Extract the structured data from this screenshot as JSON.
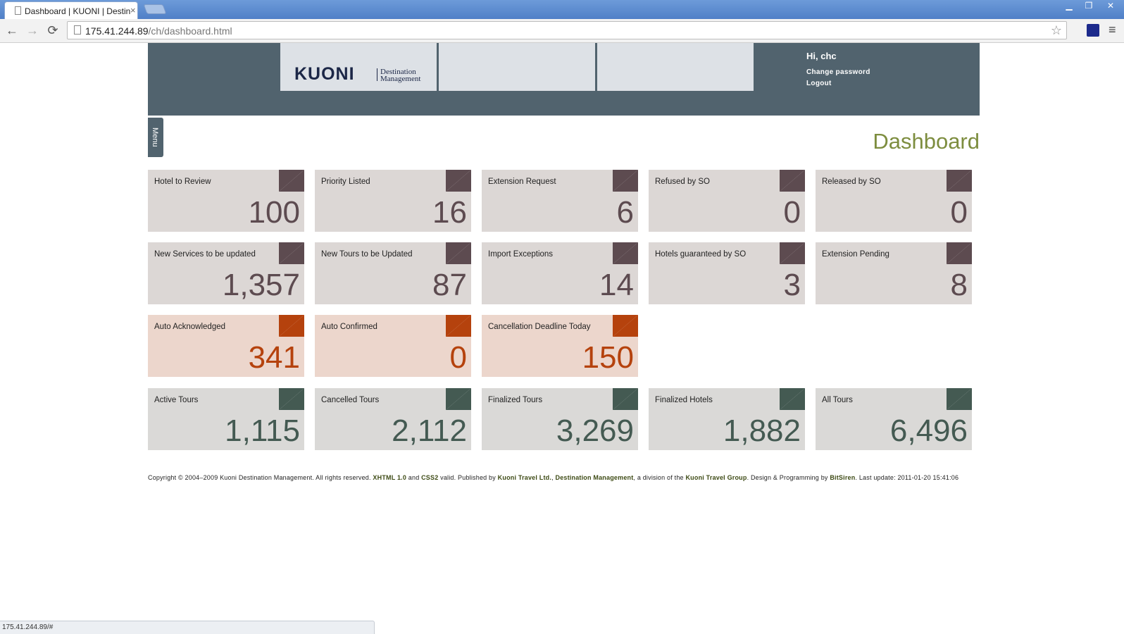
{
  "browser": {
    "tab_title": "Dashboard | KUONI | Destinati",
    "tab_close": "×",
    "url_host": "175.41.244.89",
    "url_path": "/ch/dashboard.html",
    "win_minimize": "▁",
    "win_restore": "❐",
    "win_close": "✕",
    "back": "←",
    "forward": "→",
    "reload": "⟳",
    "star": "☆",
    "menu": "≡"
  },
  "header": {
    "logo_word": "KUONI",
    "logo_sub_1": "Destination",
    "logo_sub_2": "Management",
    "greeting": "Hi, chc",
    "change_password": "Change password",
    "logout": "Logout"
  },
  "menu_tab": "Menu",
  "page_title": "Dashboard",
  "tiles": {
    "hotel_to_review": {
      "label": "Hotel to Review",
      "value": "100"
    },
    "priority_listed": {
      "label": "Priority Listed",
      "value": "16"
    },
    "extension_request": {
      "label": "Extension Request",
      "value": "6"
    },
    "refused_by_so": {
      "label": "Refused by SO",
      "value": "0"
    },
    "released_by_so": {
      "label": "Released by SO",
      "value": "0"
    },
    "new_services": {
      "label": "New Services to be updated",
      "value": "1,357"
    },
    "new_tours": {
      "label": "New Tours to be Updated",
      "value": "87"
    },
    "import_exceptions": {
      "label": "Import Exceptions",
      "value": "14"
    },
    "hotels_guaranteed": {
      "label": "Hotels guaranteed by SO",
      "value": "3"
    },
    "extension_pending": {
      "label": "Extension Pending",
      "value": "8"
    },
    "auto_acknowledged": {
      "label": "Auto Acknowledged",
      "value": "341"
    },
    "auto_confirmed": {
      "label": "Auto Confirmed",
      "value": "0"
    },
    "cancellation_deadline": {
      "label": "Cancellation Deadline Today",
      "value": "150"
    },
    "active_tours": {
      "label": "Active Tours",
      "value": "1,115"
    },
    "cancelled_tours": {
      "label": "Cancelled Tours",
      "value": "2,112"
    },
    "finalized_tours": {
      "label": "Finalized Tours",
      "value": "3,269"
    },
    "finalized_hotels": {
      "label": "Finalized Hotels",
      "value": "1,882"
    },
    "all_tours": {
      "label": "All Tours",
      "value": "6,496"
    }
  },
  "colors": {
    "header_bg": "#51636e",
    "title": "#7d8d3f",
    "grey_tile": "#dcd7d5",
    "grey_value": "#5d4b50",
    "orange_tile": "#ecd6cc",
    "orange_value": "#b5420d",
    "green_tile": "#dad9d7",
    "green_value": "#445a52"
  },
  "footer": {
    "t1": "Copyright © 2004–2009 Kuoni Destination Management. All rights reserved. ",
    "xhtml": "XHTML 1.0",
    "t2": " and ",
    "css": "CSS2",
    "t3": " valid. Published by ",
    "kuoni_travel": "Kuoni Travel Ltd.",
    "t4": ", ",
    "dm": "Destination Management",
    "t5": ", a division of the ",
    "group": "Kuoni Travel Group",
    "t6": ". Design & Programming by ",
    "bitsiren": "BitSiren",
    "t7": ". Last update: 2011-01-20 15:41:06"
  },
  "status_bar": "175.41.244.89/#"
}
